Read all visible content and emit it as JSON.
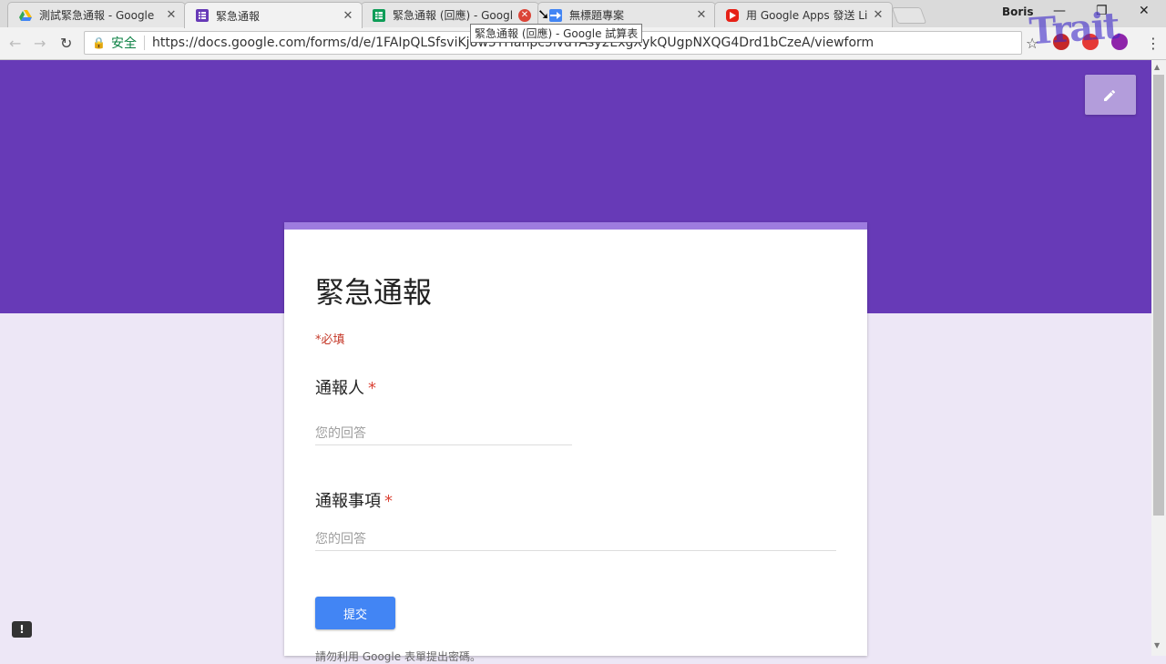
{
  "browser": {
    "tabs": [
      {
        "title": "測試緊急通報 - Google",
        "icon": "google-drive-icon",
        "color": "#1e88e5",
        "active": false
      },
      {
        "title": "緊急通報",
        "icon": "google-forms-icon",
        "color": "#673ab7",
        "active": true
      },
      {
        "title": "緊急通報 (回應) - Googl",
        "icon": "google-sheets-icon",
        "color": "#0f9d58",
        "active": false
      },
      {
        "title": "無標題專案",
        "icon": "apps-script-icon",
        "color": "#4285f4",
        "active": false
      },
      {
        "title": "用 Google Apps 發送 Li",
        "icon": "youtube-icon",
        "color": "#e62117",
        "active": false
      }
    ],
    "profile_name": "Boris",
    "security_label": "安全",
    "url": "https://docs.google.com/forms/d/e/1FAIpQLSfsviKj8w5THanpc5ivdTAsy2ExgXykQUgpNXQG4Drd1bCzeA/viewform",
    "tooltip": "緊急通報 (回應) - Google 試算表"
  },
  "form": {
    "title": "緊急通報",
    "required_note": "*必填",
    "questions": [
      {
        "label": "通報人",
        "required_mark": "*",
        "placeholder": "您的回答"
      },
      {
        "label": "通報事項",
        "required_mark": "*",
        "placeholder": "您的回答"
      }
    ],
    "submit_label": "提交",
    "footer": "請勿利用 Google 表單提出密碼。"
  },
  "colors": {
    "theme": "#673ab7",
    "background": "#ede7f6",
    "submit": "#4285f4",
    "required": "#db4437"
  }
}
